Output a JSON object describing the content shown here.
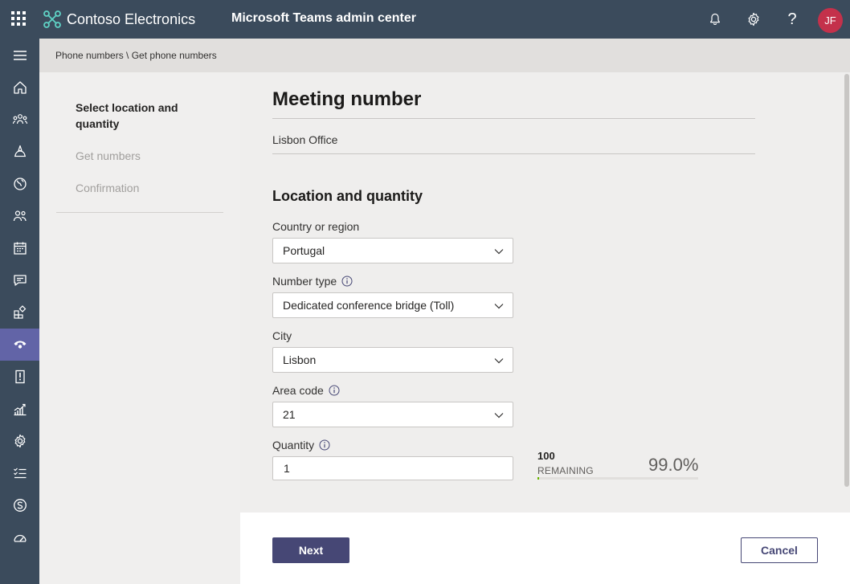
{
  "header": {
    "org_name": "Contoso Electronics",
    "app_title": "Microsoft Teams admin center",
    "avatar_initials": "JF",
    "help_label": "?",
    "icons": [
      "app-launcher-icon",
      "contoso-logo-icon",
      "notifications-bell-icon",
      "settings-gear-icon",
      "help-icon"
    ],
    "avatar_color": "#c4314b"
  },
  "nav": {
    "items": [
      {
        "icon": "menu-icon"
      },
      {
        "icon": "home-icon"
      },
      {
        "icon": "teams-icon"
      },
      {
        "icon": "devices-icon"
      },
      {
        "icon": "locations-icon"
      },
      {
        "icon": "users-icon"
      },
      {
        "icon": "meetings-icon"
      },
      {
        "icon": "messaging-icon"
      },
      {
        "icon": "apps-icon"
      },
      {
        "icon": "voice-icon",
        "active": true
      },
      {
        "icon": "policy-packages-icon"
      },
      {
        "icon": "analytics-icon"
      },
      {
        "icon": "org-settings-icon"
      },
      {
        "icon": "planning-icon"
      },
      {
        "icon": "skype-icon"
      },
      {
        "icon": "call-quality-icon"
      }
    ]
  },
  "breadcrumb": "Phone numbers \\ Get phone numbers",
  "steps": [
    {
      "label": "Select location and quantity",
      "state": "current"
    },
    {
      "label": "Get numbers",
      "state": "pending"
    },
    {
      "label": "Confirmation",
      "state": "pending"
    }
  ],
  "main": {
    "title": "Meeting number",
    "office": "Lisbon Office",
    "section_title": "Location and quantity",
    "fields": {
      "country": {
        "label": "Country or region",
        "value": "Portugal"
      },
      "number_type": {
        "label": "Number type",
        "value": "Dedicated conference bridge (Toll)"
      },
      "city": {
        "label": "City",
        "value": "Lisbon"
      },
      "area_code": {
        "label": "Area code",
        "value": "21"
      },
      "quantity": {
        "label": "Quantity",
        "value": "1"
      }
    },
    "remaining": {
      "count": "100",
      "label": "REMAINING",
      "percent": "99.0%",
      "used_fraction": 0.01
    }
  },
  "footer": {
    "next_label": "Next",
    "cancel_label": "Cancel"
  },
  "colors": {
    "header_bg": "#3b4b5c",
    "accent": "#6264a7",
    "primary_button": "#464775",
    "progress_fill": "#6bb700"
  }
}
